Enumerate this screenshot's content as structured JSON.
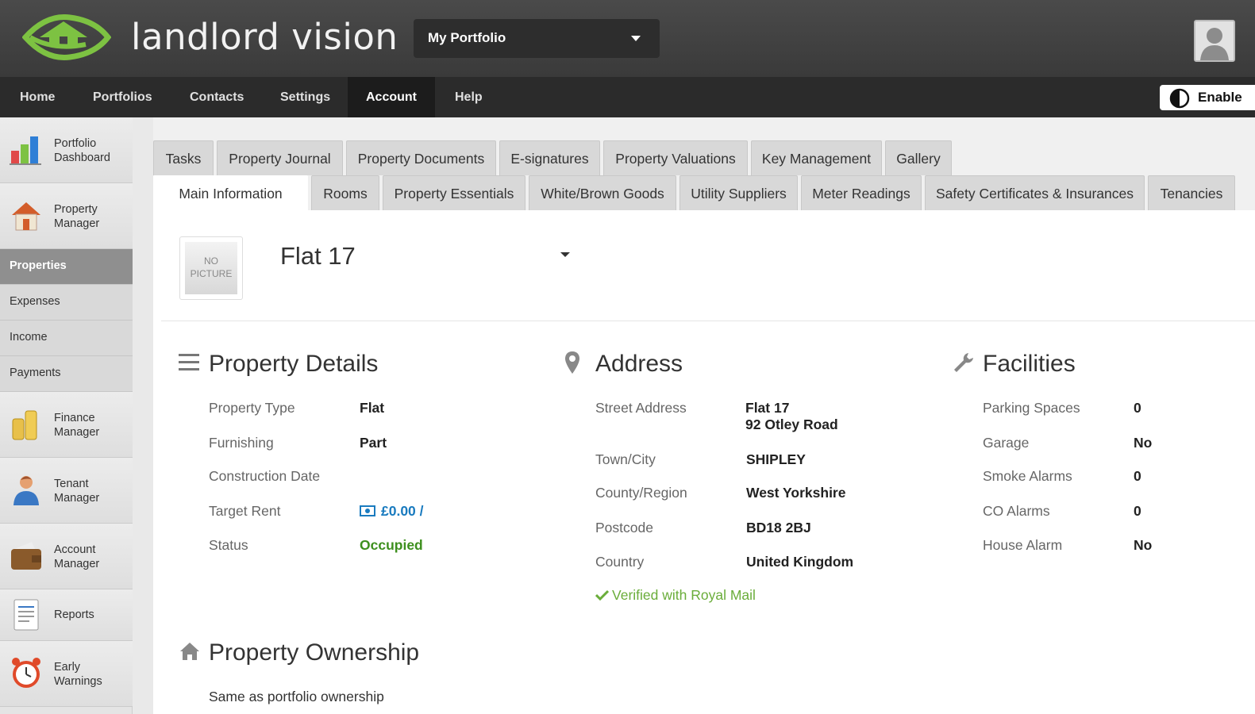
{
  "header": {
    "brand": "landlord vision",
    "portfolio_select": "My Portfolio"
  },
  "nav": {
    "items": [
      "Home",
      "Portfolios",
      "Contacts",
      "Settings",
      "Account",
      "Help"
    ],
    "active": "Account",
    "enable_label": "Enable"
  },
  "sidebar": {
    "blocks": [
      {
        "label1": "Portfolio",
        "label2": "Dashboard"
      },
      {
        "label1": "Property",
        "label2": "Manager"
      },
      {
        "label1": "Finance",
        "label2": "Manager"
      },
      {
        "label1": "Tenant",
        "label2": "Manager"
      },
      {
        "label1": "Account",
        "label2": "Manager"
      },
      {
        "label1": "Reports",
        "label2": ""
      },
      {
        "label1": "Early",
        "label2": "Warnings"
      }
    ],
    "sub_items": [
      "Properties",
      "Expenses",
      "Income",
      "Payments"
    ],
    "active_sub": "Properties"
  },
  "tabs": {
    "row1": [
      "Tasks",
      "Property Journal",
      "Property Documents",
      "E-signatures",
      "Property Valuations",
      "Key Management",
      "Gallery"
    ],
    "row2": [
      "Main Information",
      "Rooms",
      "Property Essentials",
      "White/Brown Goods",
      "Utility Suppliers",
      "Meter Readings",
      "Safety Certificates & Insurances",
      "Tenancies"
    ],
    "active": "Main Information"
  },
  "property": {
    "no_picture_line1": "NO",
    "no_picture_line2": "PICTURE",
    "name": "Flat 17"
  },
  "details": {
    "title": "Property Details",
    "rows": [
      {
        "label": "Property Type",
        "value": "Flat"
      },
      {
        "label": "Furnishing",
        "value": "Part"
      },
      {
        "label": "Construction Date",
        "value": ""
      },
      {
        "label": "Target Rent",
        "value": "£0.00 /"
      },
      {
        "label": "Status",
        "value": "Occupied"
      }
    ]
  },
  "address": {
    "title": "Address",
    "street_label": "Street Address",
    "street_line1": "Flat 17",
    "street_line2": "92 Otley Road",
    "rows": [
      {
        "label": "Town/City",
        "value": "SHIPLEY"
      },
      {
        "label": "County/Region",
        "value": "West Yorkshire"
      },
      {
        "label": "Postcode",
        "value": "BD18 2BJ"
      },
      {
        "label": "Country",
        "value": "United Kingdom"
      }
    ],
    "verified": "Verified with Royal Mail"
  },
  "facilities": {
    "title": "Facilities",
    "rows": [
      {
        "label": "Parking Spaces",
        "value": "0"
      },
      {
        "label": "Garage",
        "value": "No"
      },
      {
        "label": "Smoke Alarms",
        "value": "0"
      },
      {
        "label": "CO Alarms",
        "value": "0"
      },
      {
        "label": "House Alarm",
        "value": "No"
      }
    ]
  },
  "ownership": {
    "title": "Property Ownership",
    "text": "Same as portfolio ownership"
  },
  "colors": {
    "accent_green": "#7dc242",
    "status_green": "#3d8f1e",
    "link_blue": "#1a7bbf"
  }
}
